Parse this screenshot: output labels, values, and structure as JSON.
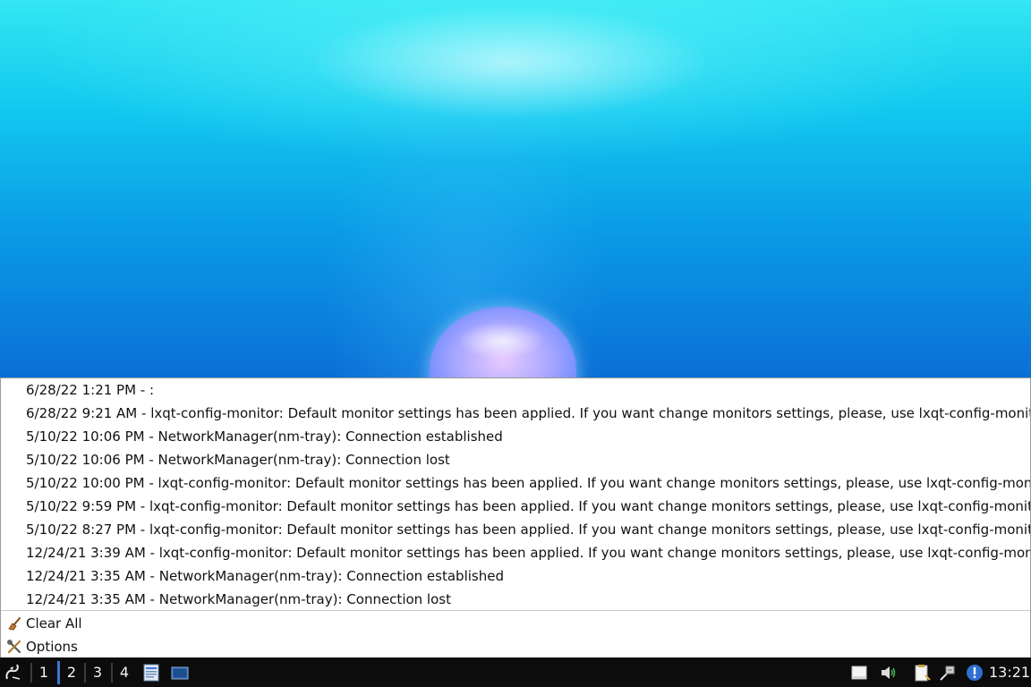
{
  "notifications": [
    "6/28/22 1:21 PM - :",
    "6/28/22 9:21 AM - lxqt-config-monitor: Default monitor settings has been applied. If you want change monitors settings, please, use lxqt-config-monit",
    "5/10/22 10:06 PM - NetworkManager(nm-tray): Connection established",
    "5/10/22 10:06 PM - NetworkManager(nm-tray): Connection lost",
    "5/10/22 10:00 PM - lxqt-config-monitor: Default monitor settings has been applied. If you want change monitors settings, please, use lxqt-config-mon",
    "5/10/22 9:59 PM - lxqt-config-monitor: Default monitor settings has been applied. If you want change monitors settings, please, use lxqt-config-monit",
    "5/10/22 8:27 PM - lxqt-config-monitor: Default monitor settings has been applied. If you want change monitors settings, please, use lxqt-config-monit",
    "12/24/21 3:39 AM - lxqt-config-monitor: Default monitor settings has been applied. If you want change monitors settings, please, use lxqt-config-mon",
    "12/24/21 3:35 AM - NetworkManager(nm-tray): Connection established",
    "12/24/21 3:35 AM - NetworkManager(nm-tray): Connection lost"
  ],
  "actions": {
    "clear_all": "Clear All",
    "options": "Options"
  },
  "taskbar": {
    "desktops": [
      "1",
      "2",
      "3",
      "4"
    ],
    "active_desktop": "2",
    "clock": "13:21",
    "tray_icons": [
      "removable-drive-icon",
      "volume-icon",
      "clipboard-icon",
      "network-icon",
      "notification-icon"
    ],
    "accent_color": "#3a76d8"
  }
}
